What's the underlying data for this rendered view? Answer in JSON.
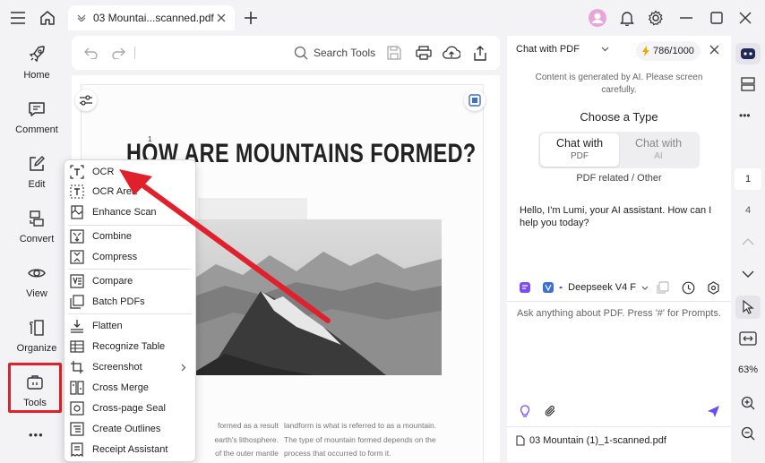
{
  "tab": {
    "title": "03 Mountai...scanned.pdf"
  },
  "rail": {
    "items": [
      {
        "label": "Home"
      },
      {
        "label": "Comment"
      },
      {
        "label": "Edit"
      },
      {
        "label": "Convert"
      },
      {
        "label": "View"
      },
      {
        "label": "Organize"
      },
      {
        "label": "Tools"
      }
    ],
    "more": "•••"
  },
  "toolbar": {
    "search_label": "Search Tools"
  },
  "document": {
    "page_marker": "1",
    "heading": "HOW ARE MOUNTAINS FORMED?",
    "col1": [
      "formed as a result",
      "earth's lithosphere.",
      "of the outer mantle"
    ],
    "col2": [
      "landform is what is referred to as a mountain.",
      "The type of mountain formed depends on the",
      "process that occurred to form it."
    ]
  },
  "menu": {
    "items": [
      {
        "label": "OCR"
      },
      {
        "label": "OCR Area"
      },
      {
        "label": "Enhance Scan"
      },
      {
        "label": "Combine"
      },
      {
        "label": "Compress"
      },
      {
        "label": "Compare"
      },
      {
        "label": "Batch PDFs"
      },
      {
        "label": "Flatten"
      },
      {
        "label": "Recognize Table"
      },
      {
        "label": "Screenshot"
      },
      {
        "label": "Cross Merge"
      },
      {
        "label": "Cross-page Seal"
      },
      {
        "label": "Create Outlines"
      },
      {
        "label": "Receipt Assistant"
      }
    ]
  },
  "chat": {
    "mode": "Chat with PDF",
    "credits": "786/1000",
    "notice": "Content is generated by AI. Please screen carefully.",
    "choose_type": "Choose a Type",
    "seg_active_main": "Chat with",
    "seg_active_sub": "PDF",
    "seg_inactive_main": "Chat with",
    "seg_inactive_sub": "AI",
    "related": "PDF related / Other",
    "greeting": "Hello, I'm Lumi, your AI assistant. How can I help you today?",
    "model": "Deepseek V4 F",
    "input_placeholder": "Ask anything about PDF. Press '#' for Prompts.",
    "file": "03 Mountain (1)_1-scanned.pdf"
  },
  "right_rail": {
    "page_current": "1",
    "page_total": "4",
    "zoom": "63%",
    "more": "•••"
  },
  "colors": {
    "accent": "#6b4cf5",
    "highlight_red": "#e0202a",
    "lumi": "#1f2a57"
  }
}
